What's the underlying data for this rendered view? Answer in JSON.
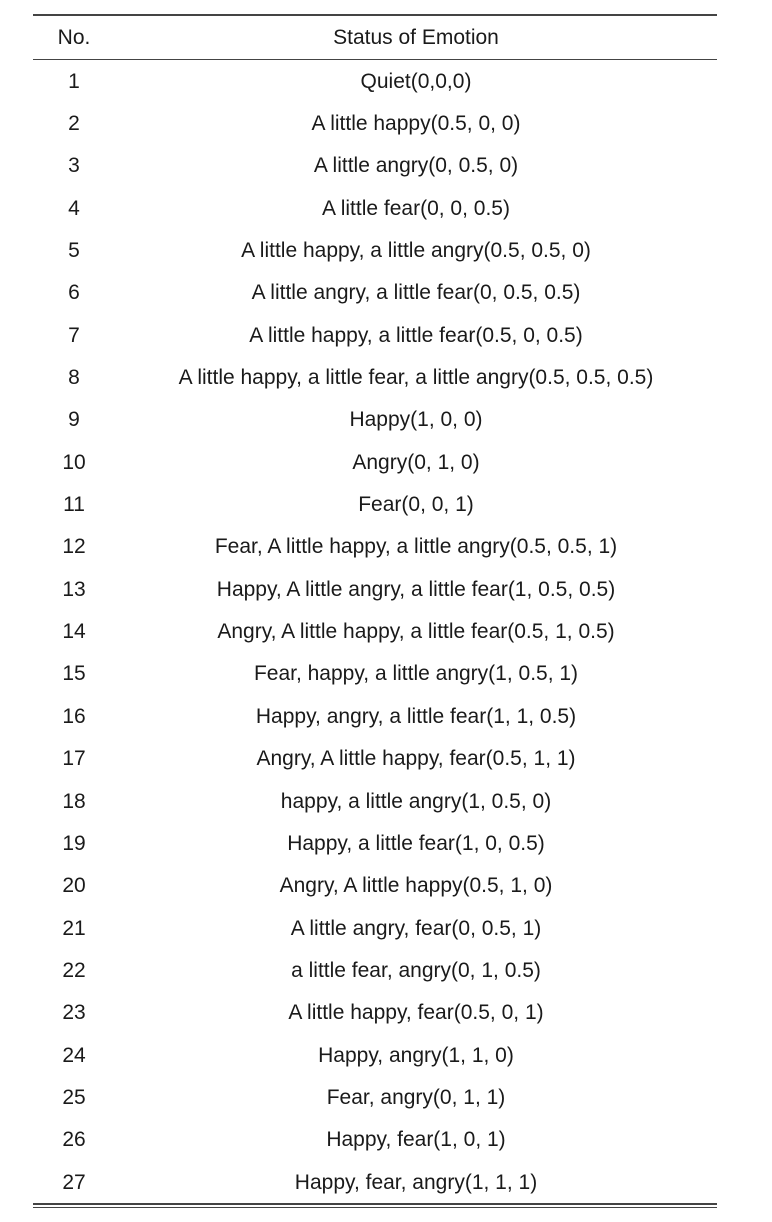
{
  "table": {
    "headers": {
      "no": "No.",
      "status": "Status of Emotion"
    },
    "rows": [
      {
        "no": "1",
        "status": "Quiet(0,0,0)"
      },
      {
        "no": "2",
        "status": "A little happy(0.5, 0, 0)"
      },
      {
        "no": "3",
        "status": "A little angry(0, 0.5, 0)"
      },
      {
        "no": "4",
        "status": "A little fear(0, 0, 0.5)"
      },
      {
        "no": "5",
        "status": "A little happy, a little angry(0.5, 0.5, 0)"
      },
      {
        "no": "6",
        "status": "A little angry, a little fear(0, 0.5, 0.5)"
      },
      {
        "no": "7",
        "status": "A little happy, a little fear(0.5, 0, 0.5)"
      },
      {
        "no": "8",
        "status": "A little happy, a little fear, a little angry(0.5, 0.5, 0.5)"
      },
      {
        "no": "9",
        "status": "Happy(1, 0, 0)"
      },
      {
        "no": "10",
        "status": "Angry(0, 1, 0)"
      },
      {
        "no": "11",
        "status": "Fear(0, 0, 1)"
      },
      {
        "no": "12",
        "status": "Fear, A little happy, a little angry(0.5, 0.5, 1)"
      },
      {
        "no": "13",
        "status": "Happy, A little angry, a little fear(1, 0.5, 0.5)"
      },
      {
        "no": "14",
        "status": "Angry, A little happy, a little fear(0.5, 1, 0.5)"
      },
      {
        "no": "15",
        "status": "Fear, happy, a little angry(1, 0.5, 1)"
      },
      {
        "no": "16",
        "status": "Happy, angry, a little fear(1, 1, 0.5)"
      },
      {
        "no": "17",
        "status": "Angry, A little happy, fear(0.5, 1, 1)"
      },
      {
        "no": "18",
        "status": "happy, a little angry(1, 0.5, 0)"
      },
      {
        "no": "19",
        "status": "Happy, a little fear(1, 0, 0.5)"
      },
      {
        "no": "20",
        "status": "Angry, A little happy(0.5, 1, 0)"
      },
      {
        "no": "21",
        "status": "A little angry, fear(0, 0.5, 1)"
      },
      {
        "no": "22",
        "status": "a little fear, angry(0, 1, 0.5)"
      },
      {
        "no": "23",
        "status": "A little happy, fear(0.5, 0, 1)"
      },
      {
        "no": "24",
        "status": "Happy, angry(1, 1, 0)"
      },
      {
        "no": "25",
        "status": "Fear, angry(0, 1, 1)"
      },
      {
        "no": "26",
        "status": "Happy, fear(1, 0, 1)"
      },
      {
        "no": "27",
        "status": "Happy, fear, angry(1, 1, 1)"
      }
    ]
  }
}
